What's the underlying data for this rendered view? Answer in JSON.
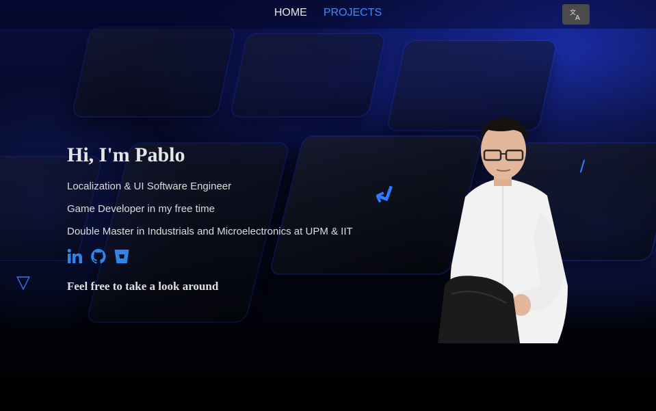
{
  "nav": {
    "items": [
      {
        "label": "HOME",
        "active": false
      },
      {
        "label": "PROJECTS",
        "active": true
      }
    ],
    "translate_icon": "translate-icon"
  },
  "hero": {
    "title": "Hi, I'm Pablo",
    "lines": [
      "Localization & UI Software Engineer",
      "Game Developer in my free time",
      "Double Master in Industrials and Microelectronics at UPM & IIT"
    ],
    "socials": [
      {
        "icon": "linkedin-icon"
      },
      {
        "icon": "github-icon"
      },
      {
        "icon": "bitbucket-icon"
      }
    ],
    "tagline": "Feel free to take a look around"
  },
  "colors": {
    "accent": "#3d8bff",
    "social": "#2f86e8",
    "background": "#000000"
  }
}
